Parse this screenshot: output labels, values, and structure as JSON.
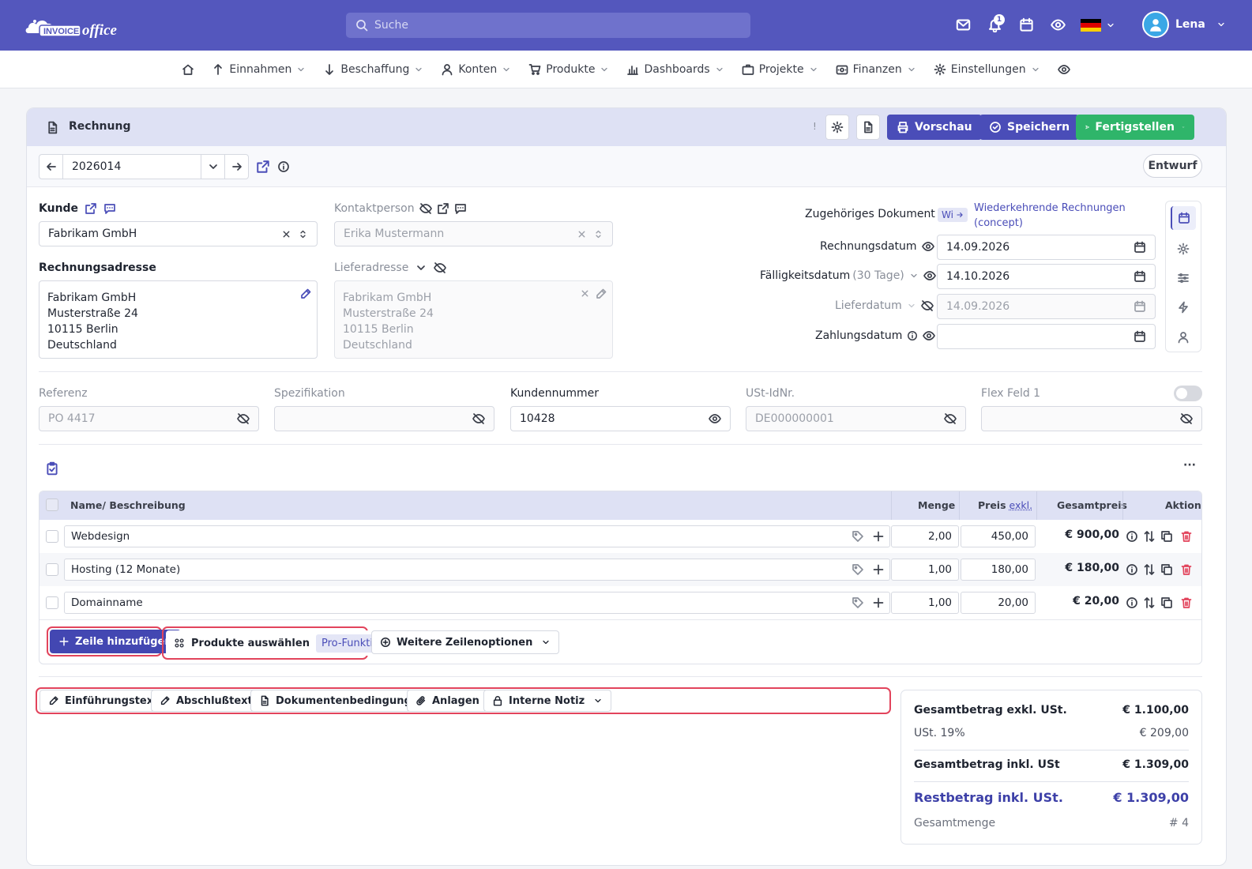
{
  "top": {
    "logo_text": "INVOICEoffice",
    "search_placeholder": "Suche",
    "notification_count": "1",
    "user_name": "Lena"
  },
  "nav": {
    "items": [
      {
        "label": "Einnahmen"
      },
      {
        "label": "Beschaffung"
      },
      {
        "label": "Konten"
      },
      {
        "label": "Produkte"
      },
      {
        "label": "Dashboards"
      },
      {
        "label": "Projekte"
      },
      {
        "label": "Finanzen"
      },
      {
        "label": "Einstellungen"
      }
    ]
  },
  "header": {
    "title": "Rechnung",
    "warn": "!",
    "preview": "Vorschau",
    "save": "Speichern",
    "finish": "Fertigstellen",
    "status": "Entwurf",
    "doc_number": "2026014"
  },
  "form": {
    "kunde_label": "Kunde",
    "kunde_value": "Fabrikam GmbH",
    "kontakt_label": "Kontaktperson",
    "kontakt_value": "Erika Mustermann",
    "rechnungsadresse_label": "Rechnungsadresse",
    "rechnungsadresse": [
      "Fabrikam GmbH",
      "Musterstraße 24",
      "10115 Berlin",
      "Deutschland"
    ],
    "lieferadresse_label": "Lieferadresse",
    "lieferadresse": [
      "Fabrikam GmbH",
      "Musterstraße 24",
      "10115 Berlin",
      "Deutschland"
    ],
    "zug_dok_label": "Zugehöriges Dokument",
    "zug_dok_tag": "Wi",
    "zug_dok_link": "Wiederkehrende Rechnungen",
    "zug_dok_sub": "(concept)",
    "rechnungsdatum_label": "Rechnungsdatum",
    "rechnungsdatum": "14.09.2026",
    "faellig_label": "Fälligkeitsdatum",
    "faellig_sub": "(30 Tage)",
    "faellig": "14.10.2026",
    "liefer_label": "Lieferdatum",
    "liefer": "14.09.2026",
    "zahlung_label": "Zahlungsdatum",
    "zahlung": "",
    "referenz_label": "Referenz",
    "referenz": "PO 4417",
    "spez_label": "Spezifikation",
    "spez": "",
    "kundennr_label": "Kundennummer",
    "kundennr": "10428",
    "ust_label": "USt-IdNr.",
    "ust": "DE000000001",
    "flex_label": "Flex Feld 1",
    "flex": ""
  },
  "table": {
    "col_name": "Name/ Beschreibung",
    "col_menge": "Menge",
    "col_preis": "Preis",
    "col_preis_sub": "exkl.",
    "col_gesamt": "Gesamtpreis",
    "col_aktion": "Aktion",
    "rows": [
      {
        "name": "Webdesign",
        "menge": "2,00",
        "preis": "450,00",
        "gesamt": "€ 900,00"
      },
      {
        "name": "Hosting (12 Monate)",
        "menge": "1,00",
        "preis": "180,00",
        "gesamt": "€ 180,00"
      },
      {
        "name": "Domainname",
        "menge": "1,00",
        "preis": "20,00",
        "gesamt": "€ 20,00"
      }
    ],
    "add_row": "Zeile hinzufügen",
    "select_products": "Produkte auswählen",
    "pro_badge": "Pro-Funktion",
    "more_options": "Weitere Zeilenoptionen",
    "more_menu": "···"
  },
  "texts": {
    "intro": "Einführungstext",
    "closing": "Abschlußtext",
    "terms": "Dokumentenbedingungen",
    "attachments": "Anlagen",
    "note": "Interne Notiz"
  },
  "summary": {
    "net_label": "Gesamtbetrag exkl. USt.",
    "net": "€ 1.100,00",
    "tax_label": "USt. 19%",
    "tax": "€ 209,00",
    "gross_label": "Gesamtbetrag inkl. USt",
    "gross": "€ 1.309,00",
    "rest_label": "Restbetrag inkl. USt.",
    "rest": "€ 1.309,00",
    "qty_label": "Gesamtmenge",
    "qty": "# 4"
  }
}
